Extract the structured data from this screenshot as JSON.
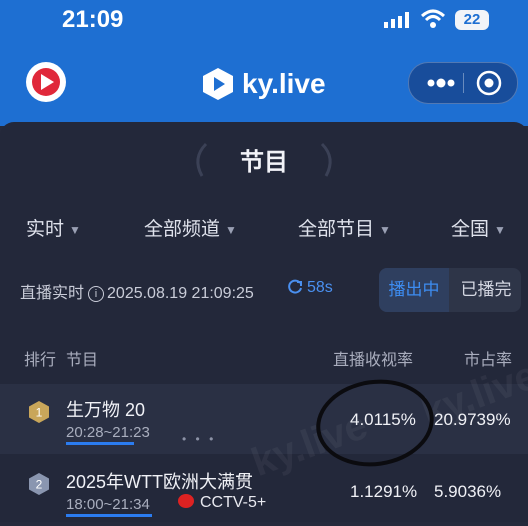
{
  "status": {
    "time": "21:09",
    "battery": "22"
  },
  "app": {
    "brand": "ky.live"
  },
  "section": {
    "title": "节目"
  },
  "filters": [
    {
      "label": "实时"
    },
    {
      "label": "全部频道"
    },
    {
      "label": "全部节目"
    },
    {
      "label": "全国"
    }
  ],
  "live": {
    "label": "直播实时",
    "timestamp": "2025.08.19 21:09:25",
    "refresh": "58s",
    "toggle_on": "播出中",
    "toggle_off": "已播完"
  },
  "table": {
    "headers": {
      "rank": "排行",
      "program": "节目",
      "rating": "直播收视率",
      "share": "市占率"
    },
    "rows": [
      {
        "rank": "1",
        "name": "生万物 20",
        "time": "20:28~21:23",
        "rating": "4.0115%",
        "share": "20.9739%",
        "channel": "",
        "progress": 0.75
      },
      {
        "rank": "2",
        "name": "2025年WTT欧洲大满贯",
        "time": "18:00~21:34",
        "rating": "1.1291%",
        "share": "5.9036%",
        "channel": "CCTV-5+",
        "progress": 0.95
      }
    ]
  },
  "colors": {
    "accent": "#1e6fd2",
    "live_blue": "#3d8cf0",
    "gold_rank": "#c9a65a",
    "silver_rank": "#8a96b0"
  },
  "icons": [
    "app-logo-icon",
    "ky-logo-icon",
    "more-icon",
    "target-icon",
    "info-icon",
    "refresh-icon",
    "caret-down-icon",
    "laurel-icon",
    "rank-badge-icon",
    "cctv-logo-icon"
  ]
}
